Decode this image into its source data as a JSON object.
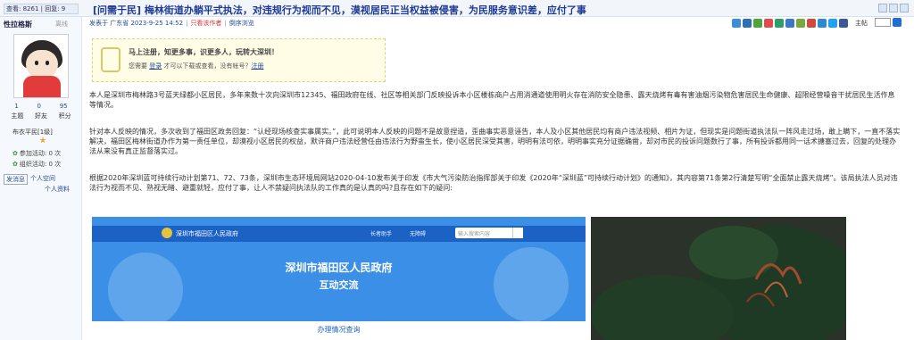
{
  "thread": {
    "stats": "查看: 8261 | 回复: 9",
    "title": "[问需于民] 梅林街道办躺平式执法，对违规行为视而不见，漠视居民正当权益被侵害，为民服务意识差，应付了事",
    "floor_label": "主帖"
  },
  "sidebar": {
    "username": "性拉格斯",
    "status": "离线",
    "stats": [
      {
        "value": "1",
        "label": "主题"
      },
      {
        "value": "0",
        "label": "好友"
      },
      {
        "value": "95",
        "label": "积分"
      }
    ],
    "rank": "布衣平民[1级]",
    "medals": [
      "参加活动: 0 次",
      "组织活动: 0 次"
    ],
    "send_message": "发消息",
    "personal_space": "个人空间",
    "personal_info": "个人资料"
  },
  "post_meta": {
    "posted_at": "发表于 广东省 2023-9-25 14:52",
    "only_author": "只看该作者",
    "reverse_order": "倒序浏览"
  },
  "notice": {
    "headline": "马上注册，知更多事，识更多人，玩转大深圳！",
    "prefix": "您需要",
    "login": "登录",
    "middle": "才可以下载或查看，没有帐号？",
    "register": "注册"
  },
  "body": {
    "p1": "本人是深圳市梅林路3号蓝天绿都小区居民，多年来数十次向深圳市12345、福田政府在线、社区等相关部门反映投诉本小区楼栋商户占用消通道使用明火存在消防安全隐患、露天烧烤有毒有害油烟污染物危害居民生命健康、超限经营噪音干扰居民生活作息等情况。",
    "p2": "针对本人反映的情况，多次收到了福田区政务回复：“认经现场核查实事属实。”，此可说明本人反映的问题不是故意捏造，歪曲事实恶意诬告，本人及小区其他居民均有商户违法视频、相片为证，但现实是问题街道执法队一阵风走过场，敢上瞒下，一直不落实解决，福田区梅林街道办作为第一责任单位，却漠视小区居民的权益，默许商户违法经营任由违法行为野蛮生长，使小区居民深受其害，明明有法可依，明明事实充分证据确凿，却对市民的投诉问题数行了事，所有投诉都用同一话术搪塞过去，回复的处理办法从来没有真正监督落实过。",
    "p3": "根据2020年深圳蓝可持续行动计划第71、72、73条，深圳市生态环境局网站2020-04-10发布关于印发《市大气污染防治指挥部关于印发《2020年“深圳蓝”可持续行动计划》的通知》，其内容第71条第2行清楚写明“全面禁止露天烧烤”。该局执法人员对违法行为视而不见、熟视无睹、避重就轻，应付了事，让人不禁疑问执法队的工作真的是认真的吗?且存在如下的疑问:"
  },
  "gov_image": {
    "site_name": "深圳市福田区人民政府",
    "nav_elder": "长者助手",
    "nav_access": "无障碍",
    "search_placeholder": "输入搜索内容",
    "title": "深圳市福田区人民政府",
    "subtitle": "互动交流",
    "tab": "办理情况查询"
  }
}
